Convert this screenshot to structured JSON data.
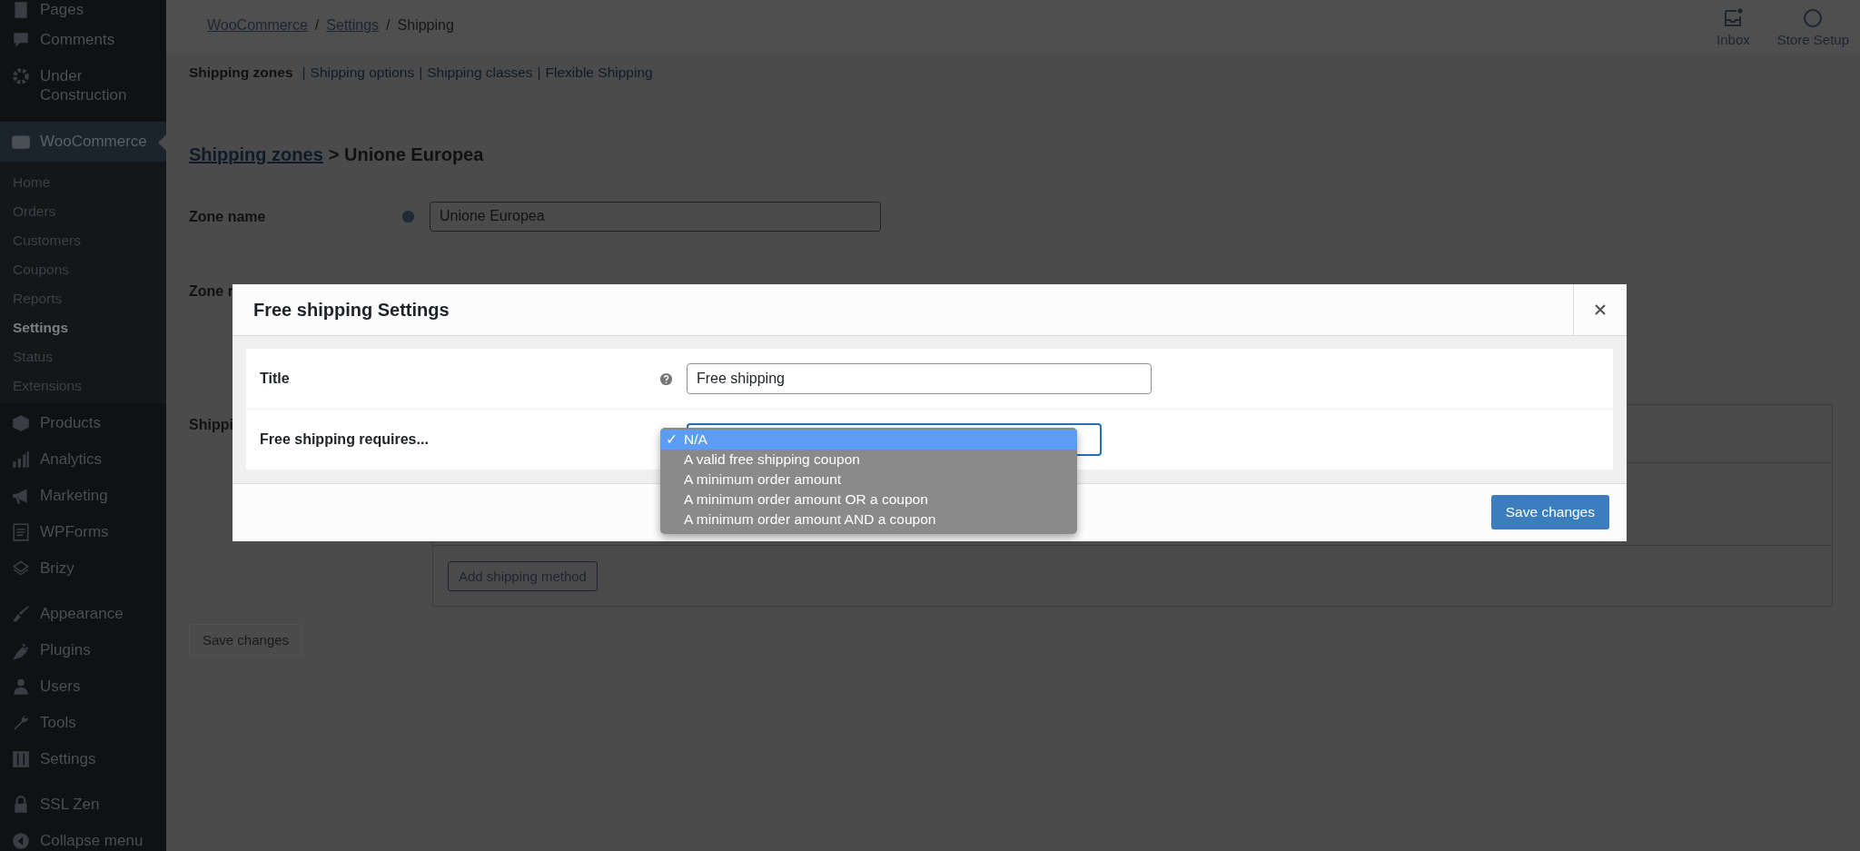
{
  "sidebar": {
    "items": [
      {
        "label": "Pages",
        "selected": false
      },
      {
        "label": "Comments",
        "selected": false
      },
      {
        "label": "Under Construction",
        "selected": false
      },
      {
        "label": "WooCommerce",
        "selected": true,
        "children": [
          {
            "label": "Home",
            "selected": false
          },
          {
            "label": "Orders",
            "selected": false
          },
          {
            "label": "Customers",
            "selected": false
          },
          {
            "label": "Coupons",
            "selected": false
          },
          {
            "label": "Reports",
            "selected": false
          },
          {
            "label": "Settings",
            "selected": true
          },
          {
            "label": "Status",
            "selected": false
          },
          {
            "label": "Extensions",
            "selected": false
          }
        ]
      },
      {
        "label": "Products",
        "selected": false
      },
      {
        "label": "Analytics",
        "selected": false
      },
      {
        "label": "Marketing",
        "selected": false
      },
      {
        "label": "WPForms",
        "selected": false
      },
      {
        "label": "Brizy",
        "selected": false
      },
      {
        "label": "Appearance",
        "selected": false
      },
      {
        "label": "Plugins",
        "selected": false
      },
      {
        "label": "Users",
        "selected": false
      },
      {
        "label": "Tools",
        "selected": false
      },
      {
        "label": "Settings",
        "selected": false
      },
      {
        "label": "SSL Zen",
        "selected": false
      },
      {
        "label": "Collapse menu",
        "selected": false
      }
    ]
  },
  "breadcrumb": {
    "separator": "/",
    "items": [
      {
        "label": "WooCommerce",
        "link": true
      },
      {
        "label": "Settings",
        "link": true
      },
      {
        "label": "Shipping",
        "link": false
      }
    ]
  },
  "header_actions": [
    {
      "label": "Inbox"
    },
    {
      "label": "Store Setup"
    }
  ],
  "subnav": {
    "separator": "|",
    "items": [
      {
        "label": "Shipping zones",
        "selected": true
      },
      {
        "label": "Shipping options",
        "selected": false
      },
      {
        "label": "Shipping classes",
        "selected": false
      },
      {
        "label": "Flexible Shipping",
        "selected": false
      }
    ]
  },
  "heading": {
    "link": "Shipping zones",
    "current": "> Unione Europea"
  },
  "zone_name": {
    "label": "Zone name",
    "value": "Unione Europea"
  },
  "zone_regions": {
    "label": "Zone r"
  },
  "shipping_methods": {
    "label": "Shippi",
    "add_button": "Add shipping method"
  },
  "save_button": {
    "label": "Save changes",
    "disabled": true
  },
  "modal": {
    "title": "Free shipping Settings",
    "fields": [
      {
        "label": "Title",
        "kind": "text",
        "help": true,
        "value": "Free shipping"
      },
      {
        "label": "Free shipping requires...",
        "kind": "select",
        "help": false
      }
    ],
    "dropdown": {
      "check": "✓",
      "options": [
        {
          "label": "N/A",
          "selected": true
        },
        {
          "label": "A valid free shipping coupon",
          "selected": false
        },
        {
          "label": "A minimum order amount",
          "selected": false
        },
        {
          "label": "A minimum order amount OR a coupon",
          "selected": false
        },
        {
          "label": "A minimum order amount AND a coupon",
          "selected": false
        }
      ]
    },
    "save_button": "Save changes"
  }
}
